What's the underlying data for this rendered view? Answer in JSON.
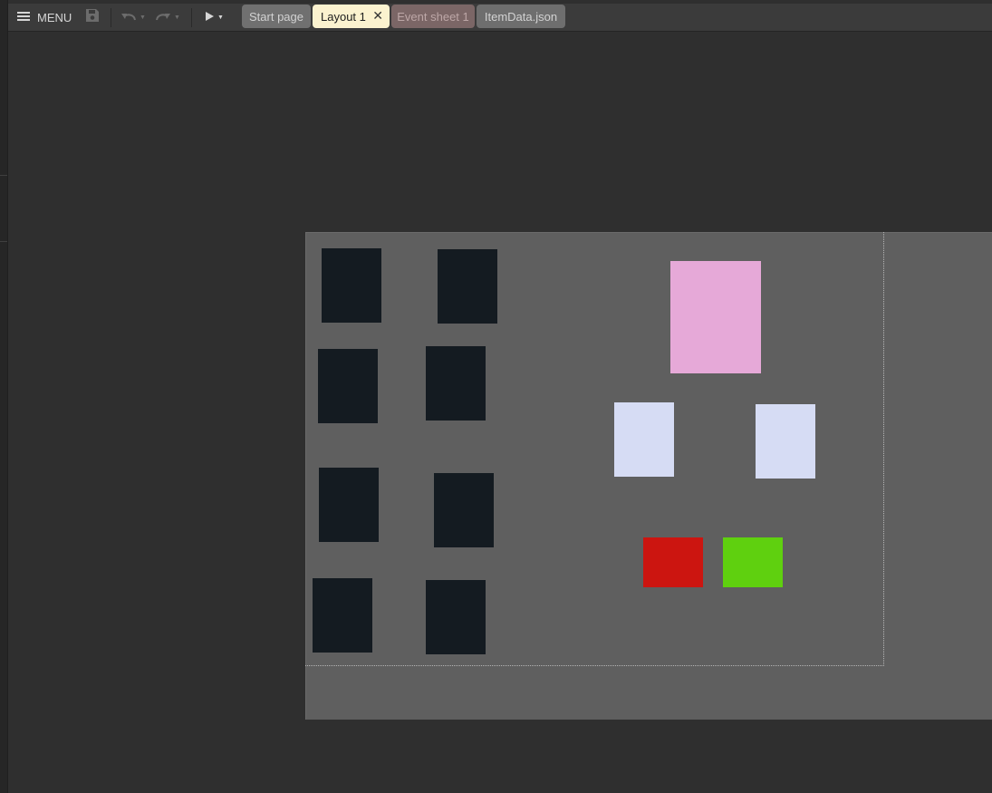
{
  "toolbar": {
    "menu_label": "MENU",
    "icons": [
      "menu-icon",
      "save-icon",
      "undo-icon",
      "redo-icon",
      "play-icon"
    ]
  },
  "tabs": [
    {
      "id": "start",
      "label": "Start page"
    },
    {
      "id": "layout",
      "label": "Layout 1",
      "active": true,
      "close": "✕"
    },
    {
      "id": "event",
      "label": "Event sheet 1"
    },
    {
      "id": "json",
      "label": "ItemData.json"
    }
  ],
  "layout": {
    "colors": {
      "slot": "#141b21",
      "pink": "#e6a9d8",
      "lavender": "#d6dcf4",
      "red": "#cc1510",
      "green": "#5fd00f",
      "background": "#5f5f5f"
    }
  }
}
